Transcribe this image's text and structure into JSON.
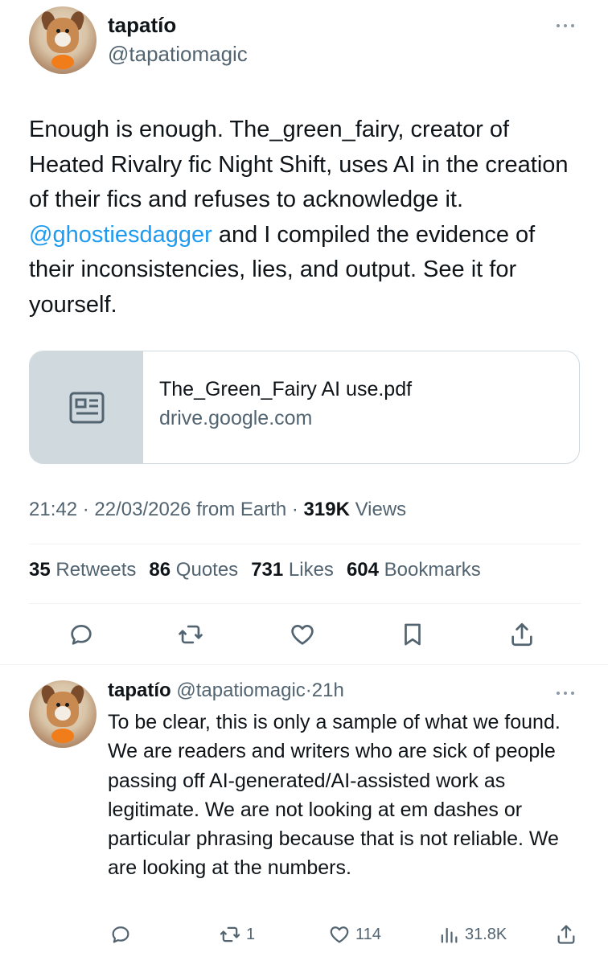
{
  "main_tweet": {
    "author_name": "tapatío",
    "author_handle": "@tapatiomagic",
    "text_before_mention": "Enough is enough. The_green_fairy, creator of Heated Rivalry fic Night Shift, uses AI in the creation of their fics and refuses to acknowledge it. ",
    "mention": "@ghostiesdagger",
    "text_after_mention": " and I compiled the evidence of their inconsistencies, lies, and output. See it for yourself.",
    "link_card": {
      "title": "The_Green_Fairy AI use.pdf",
      "domain": "drive.google.com",
      "icon": "news-article-icon"
    },
    "time": "21:42",
    "date": "22/03/2026",
    "source": "from Earth",
    "views_count": "319K",
    "views_label": "Views",
    "stats": {
      "retweets_count": "35",
      "retweets_label": "Retweets",
      "quotes_count": "86",
      "quotes_label": "Quotes",
      "likes_count": "731",
      "likes_label": "Likes",
      "bookmarks_count": "604",
      "bookmarks_label": "Bookmarks"
    },
    "actions": [
      "reply-icon",
      "retweet-icon",
      "like-icon",
      "bookmark-icon",
      "share-icon"
    ]
  },
  "reply_tweet": {
    "author_name": "tapatío",
    "author_handle": "@tapatiomagic",
    "separator": "·",
    "age": "21h",
    "text": "To be clear, this is only a sample of what we found. We are readers and writers who are sick of people passing off AI-generated/AI-assisted work as legitimate. We are not looking at em dashes or particular phrasing because that is not reliable. We are looking at the numbers.",
    "retweet_count": "1",
    "like_count": "114",
    "view_count": "31.8K"
  },
  "colors": {
    "text": "#0f1419",
    "secondary": "#536471",
    "link": "#1d9bf0",
    "border": "#cfd9de"
  }
}
